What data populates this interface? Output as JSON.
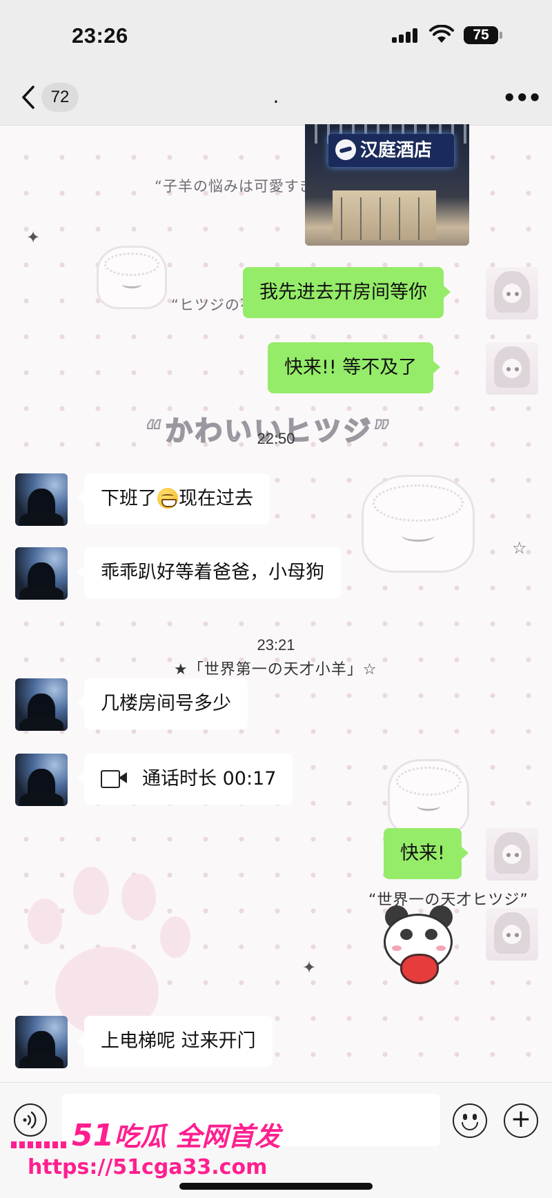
{
  "status_bar": {
    "time": "23:26",
    "battery": "75"
  },
  "nav": {
    "unread_count": "72",
    "title": "."
  },
  "wallpaper": {
    "text_1": "“子羊の悩みは可愛すぎ",
    "text_2": "“ヒツジの花",
    "big_text": "“かわいいヒツジ”",
    "text_3": "★「世界第一の天才小羊」☆",
    "text_4": "“世界一の天才ヒツジ”"
  },
  "image_message": {
    "sign_text": "汉庭酒店"
  },
  "messages": [
    {
      "side": "me",
      "text": "我先进去开房间等你"
    },
    {
      "side": "me",
      "text": "快来!!  等不及了"
    },
    {
      "timestamp": "22:50"
    },
    {
      "side": "them",
      "text_before": "下班了",
      "emoji": "grin-emoji",
      "text_after": "现在过去"
    },
    {
      "side": "them",
      "text": "乖乖趴好等着爸爸，小母狗"
    },
    {
      "timestamp": "23:21"
    },
    {
      "side": "them",
      "text": "几楼房间号多少"
    },
    {
      "side": "them",
      "type": "call",
      "text": "通话时长 00:17"
    },
    {
      "side": "me",
      "text": "快来!"
    },
    {
      "side": "them",
      "text": "上电梯呢 过来开门"
    }
  ],
  "input_bar": {
    "watermark_brand": "51",
    "watermark_text": "吃瓜 全网首发",
    "watermark_url": "https://51cga33.com"
  },
  "colors": {
    "my_bubble": "#95ec69",
    "their_bubble": "#ffffff",
    "watermark": "#ff1f8f"
  }
}
